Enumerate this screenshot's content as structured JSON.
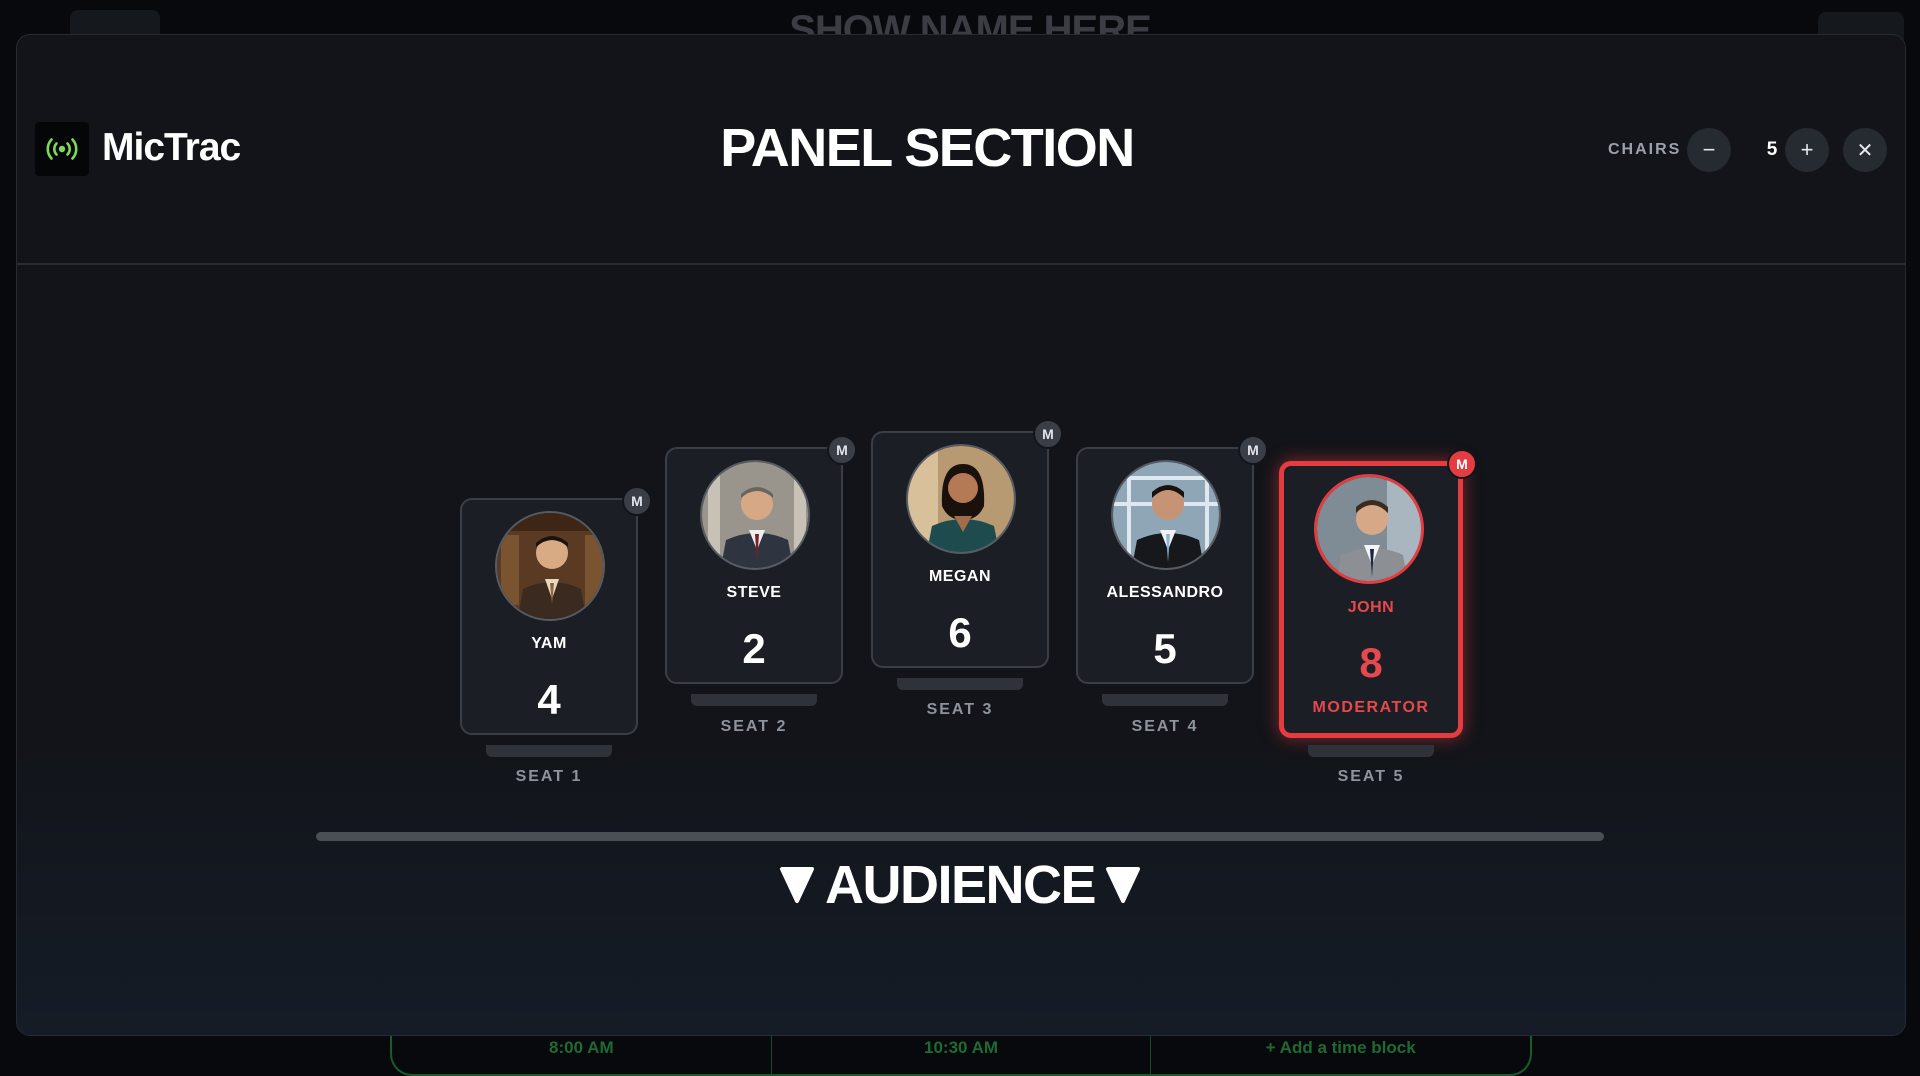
{
  "background": {
    "show_title": "SHOW NAME HERE",
    "timeline": [
      "8:00 AM",
      "10:30 AM",
      "+ Add a time block"
    ]
  },
  "header": {
    "app_name": "MicTrac",
    "logo_icon": "broadcast-icon",
    "title": "PANEL SECTION",
    "chairs_label": "CHAIRS",
    "chairs_count": "5",
    "decrement_label": "−",
    "increment_label": "+",
    "close_label": "✕"
  },
  "seats": [
    {
      "seat_label": "SEAT 1",
      "name": "YAM",
      "number": "4",
      "badge": "M",
      "role": "",
      "active": false
    },
    {
      "seat_label": "SEAT 2",
      "name": "STEVE",
      "number": "2",
      "badge": "M",
      "role": "",
      "active": false
    },
    {
      "seat_label": "SEAT 3",
      "name": "MEGAN",
      "number": "6",
      "badge": "M",
      "role": "",
      "active": false
    },
    {
      "seat_label": "SEAT 4",
      "name": "ALESSANDRO",
      "number": "5",
      "badge": "M",
      "role": "",
      "active": false
    },
    {
      "seat_label": "SEAT 5",
      "name": "JOHN",
      "number": "8",
      "badge": "M",
      "role": "MODERATOR",
      "active": true
    }
  ],
  "audience_label": "AUDIENCE",
  "colors": {
    "accent_red": "#e43c40",
    "logo_green": "#7ed957",
    "modal_bg": "#121419"
  }
}
